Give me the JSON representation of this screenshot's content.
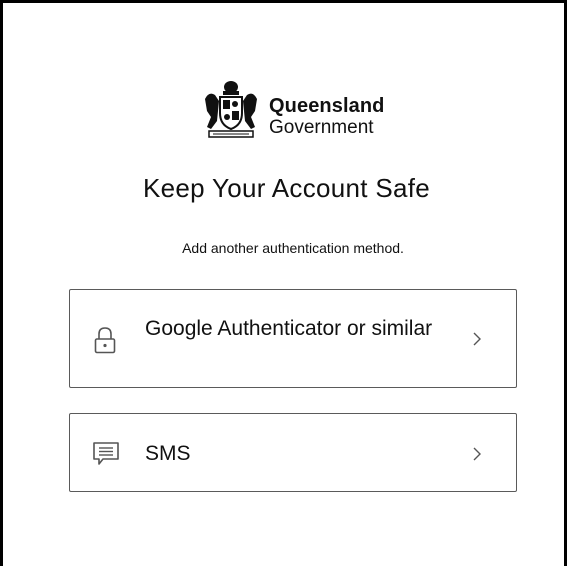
{
  "brand": {
    "line1": "Queensland",
    "line2": "Government"
  },
  "page": {
    "title": "Keep Your Account Safe",
    "subtitle": "Add another authentication method."
  },
  "options": [
    {
      "label": "Google Authenticator or similar",
      "icon": "lock-icon"
    },
    {
      "label": "SMS",
      "icon": "message-icon"
    }
  ],
  "colors": {
    "text": "#111111",
    "border": "#5a5a5a",
    "icon": "#555555"
  }
}
